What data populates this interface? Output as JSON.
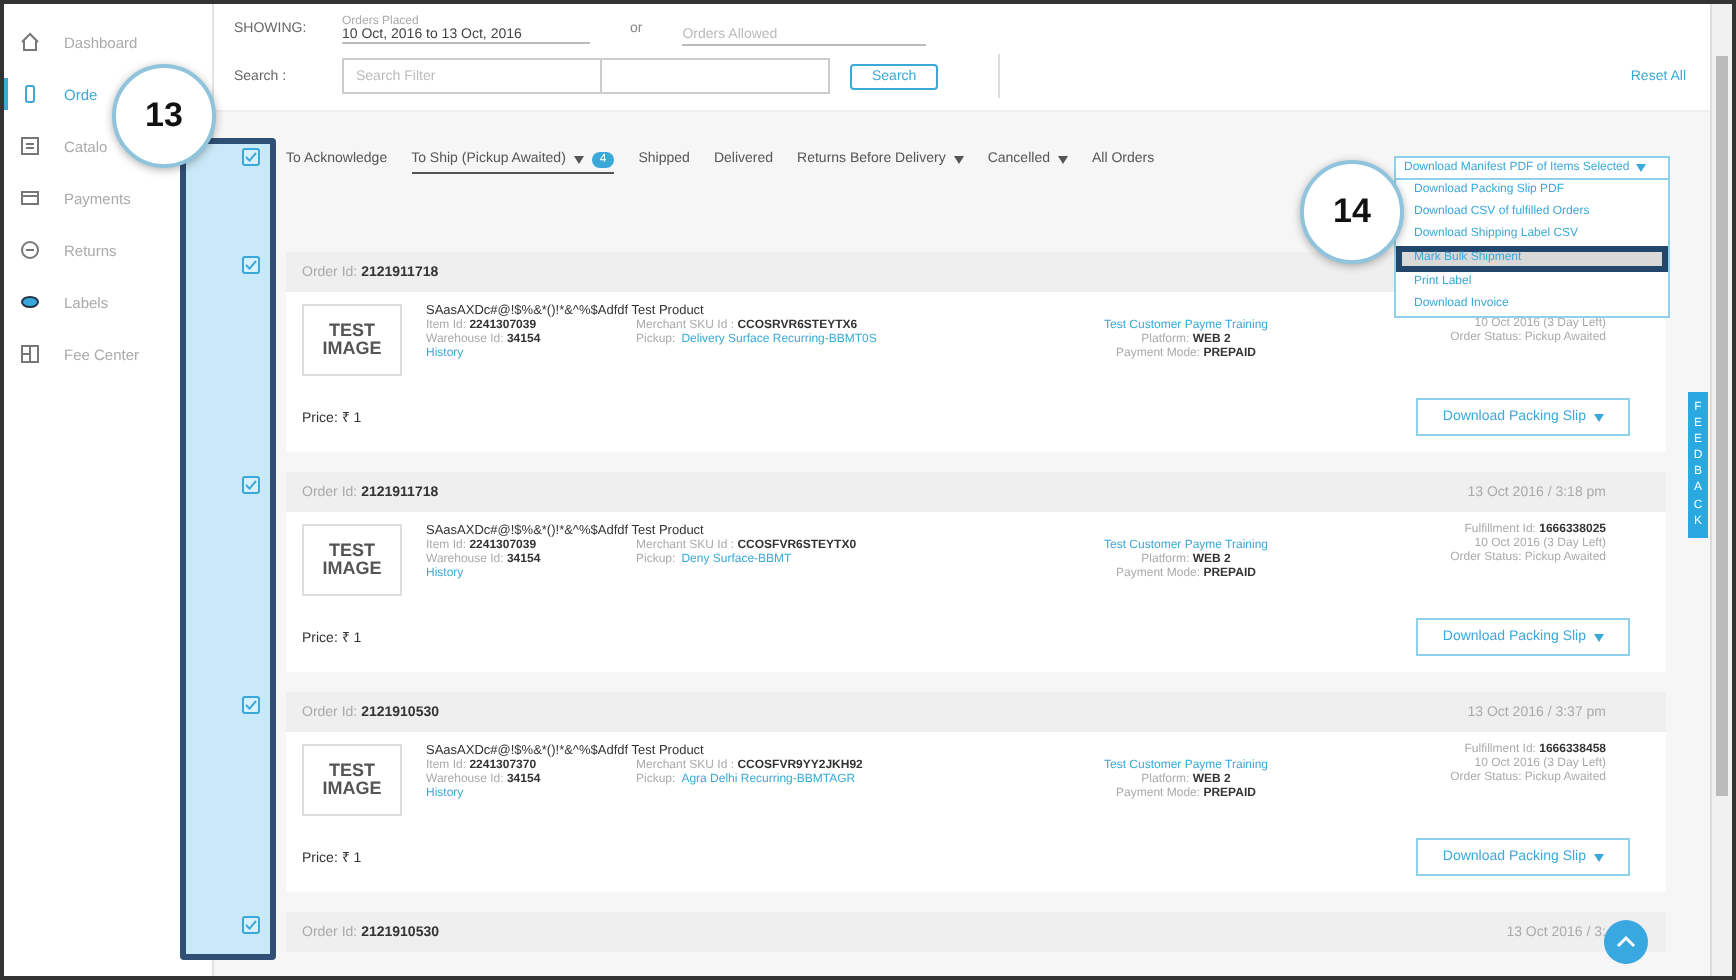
{
  "sidebar": {
    "items": [
      {
        "label": "Dashboard",
        "selected": false
      },
      {
        "label": "Orde",
        "selected": true
      },
      {
        "label": "Catalo",
        "selected": false
      },
      {
        "label": "Payments",
        "selected": false
      },
      {
        "label": "Returns",
        "selected": false
      },
      {
        "label": "Labels",
        "selected": false
      },
      {
        "label": "Fee Center",
        "selected": false
      }
    ]
  },
  "header": {
    "showing_label": "SHOWING:",
    "date_field": {
      "label": "Orders Placed",
      "value": "10 Oct, 2016 to 13 Oct, 2016"
    },
    "or": "or",
    "allowed_field": {
      "placeholder": "Orders Allowed"
    },
    "search_label": "Search :",
    "search_placeholder": "Search Filter",
    "search_button": "Search",
    "reset_link": "Reset All"
  },
  "select_all": {
    "checked": true
  },
  "tabs": [
    {
      "label": "To Acknowledge",
      "selected": false,
      "dropdown": false
    },
    {
      "label": "To Ship (Pickup Awaited)",
      "selected": true,
      "dropdown": true,
      "badge": "4"
    },
    {
      "label": "Shipped",
      "selected": false,
      "dropdown": false
    },
    {
      "label": "Delivered",
      "selected": false,
      "dropdown": false
    },
    {
      "label": "Returns Before Delivery",
      "selected": false,
      "dropdown": true
    },
    {
      "label": "Cancelled",
      "selected": false,
      "dropdown": true
    },
    {
      "label": "All Orders",
      "selected": false,
      "dropdown": false
    }
  ],
  "bulk_menu": {
    "title": "Download Manifest PDF of Items Selected",
    "items": [
      {
        "label": "Download Packing Slip PDF",
        "selected": false
      },
      {
        "label": "Download CSV of fulfilled Orders",
        "selected": false
      },
      {
        "label": "Download Shipping Label CSV",
        "selected": false
      },
      {
        "label": "Mark Bulk Shipment",
        "selected": true
      },
      {
        "label": "Print Label",
        "selected": false
      },
      {
        "label": "Download Invoice",
        "selected": false
      }
    ]
  },
  "orders": [
    {
      "checked": true,
      "order_id": "Order Id: **2121911718**",
      "image_text": "TEST IMAGE",
      "product": "SAasAXDc#@!$%&*()!*&^%$Adfdf Test Product",
      "item_id": "Item Id: **2241307039**",
      "warehouse_id": "Warehouse Id: **34154**",
      "history": "History",
      "merchant_sku": "Merchant SKU Id : **CCOSRVR6STEYTX6**",
      "pickup_label": "Pickup:",
      "pickup": "Delivery Surface Recurring-BBMT0S",
      "customer": "Test Customer Payme Training",
      "platform": "Platform: **WEB 2**",
      "payment_mode": "Payment Mode: **PREPAID**",
      "due": "10 Oct 2016 (3 Day Left)",
      "status": "Order Status: Pickup Awaited",
      "price": "Price: ₹ 1",
      "button": "Download Packing Slip"
    },
    {
      "checked": true,
      "order_id": "Order Id: **2121911718**",
      "date": "13 Oct 2016 / 3:18 pm",
      "image_text": "TEST IMAGE",
      "product": "SAasAXDc#@!$%&*()!*&^%$Adfdf Test Product",
      "item_id": "Item Id: **2241307039**",
      "warehouse_id": "Warehouse Id: **34154**",
      "history": "History",
      "merchant_sku": "Merchant SKU Id : **CCOSFVR6STEYTX0**",
      "pickup_label": "Pickup:",
      "pickup": "Deny Surface-BBMT",
      "customer": "Test Customer Payme Training",
      "platform": "Platform: **WEB 2**",
      "payment_mode": "Payment Mode: **PREPAID**",
      "fulfillment_id": "Fulfillment Id: **1666338025**",
      "due": "10 Oct 2016 (3 Day Left)",
      "status": "Order Status: Pickup Awaited",
      "price": "Price: ₹ 1",
      "button": "Download Packing Slip"
    },
    {
      "checked": true,
      "order_id": "Order Id: **2121910530**",
      "date": "13 Oct 2016 / 3:37 pm",
      "image_text": "TEST IMAGE",
      "product": "SAasAXDc#@!$%&*()!*&^%$Adfdf Test Product",
      "item_id": "Item Id: **2241307370**",
      "warehouse_id": "Warehouse Id: **34154**",
      "history": "History",
      "merchant_sku": "Merchant SKU Id : **CCOSFVR9YY2JKH92**",
      "pickup_label": "Pickup:",
      "pickup": "Agra Delhi Recurring-BBMTAGR",
      "customer": "Test Customer Payme Training",
      "platform": "Platform: **WEB 2**",
      "payment_mode": "Payment Mode: **PREPAID**",
      "fulfillment_id": "Fulfillment Id: **1666338458**",
      "due": "10 Oct 2016 (3 Day Left)",
      "status": "Order Status: Pickup Awaited",
      "price": "Price: ₹ 1",
      "button": "Download Packing Slip"
    },
    {
      "checked": true,
      "order_id": "Order Id: **2121910530**",
      "date": "13 Oct 2016 / 3:"
    }
  ],
  "callouts": [
    "13",
    "14"
  ],
  "feedback_tab": "FEEDBACK"
}
